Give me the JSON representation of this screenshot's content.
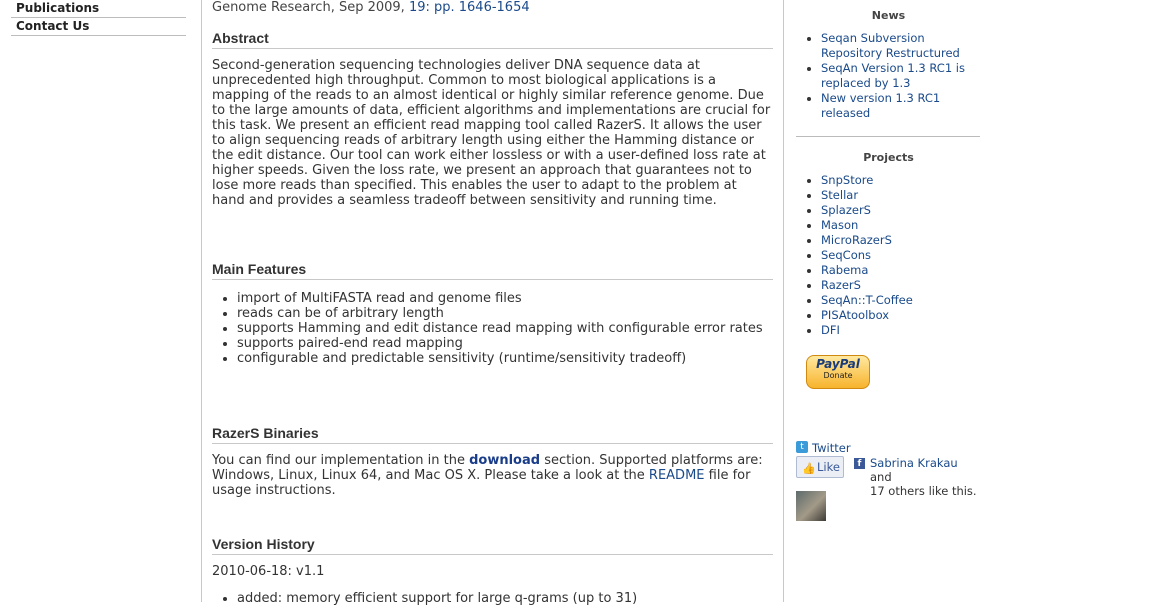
{
  "nav": {
    "items": [
      {
        "label": "Publications"
      },
      {
        "label": "Contact Us"
      }
    ]
  },
  "main": {
    "citation": {
      "text": "Genome Research, Sep 2009, ",
      "link": "19: pp. 1646-1654"
    },
    "abstract": {
      "heading": "Abstract",
      "text": "Second-generation sequencing technologies deliver DNA sequence data at unprecedented high throughput. Common to most biological applications is a mapping of the reads to an almost identical or highly similar reference genome. Due to the large amounts of data, efficient algorithms and implementations are crucial for this task. We present an efficient read mapping tool called RazerS. It allows the user to align sequencing reads of arbitrary length using either the Hamming distance or the edit distance. Our tool can work either lossless or with a user-defined loss rate at higher speeds. Given the loss rate, we present an approach that guarantees not to lose more reads than specified. This enables the user to adapt to the problem at hand and provides a seamless tradeoff between sensitivity and running time."
    },
    "features": {
      "heading": "Main Features",
      "items": [
        "import of MultiFASTA read and genome files",
        "reads can be of arbitrary length",
        "supports Hamming and edit distance read mapping with configurable error rates",
        "supports paired-end read mapping",
        "configurable and predictable sensitivity (runtime/sensitivity tradeoff)"
      ]
    },
    "binaries": {
      "heading": "RazerS Binaries",
      "text1": "You can find our implementation in the ",
      "download_link": "download",
      "text2": " section. Supported platforms are: Windows, Linux, Linux 64, and Mac OS X. Please take a look at the ",
      "readme_link": "README",
      "text3": " file for usage instructions."
    },
    "history": {
      "heading": "Version History",
      "version": "2010-06-18: v1.1",
      "items": [
        "added: memory efficient support for large q-grams (up to 31)"
      ]
    }
  },
  "sidebar": {
    "news": {
      "title": "News",
      "items": [
        "Seqan Subversion Repository Restructured",
        "SeqAn Version 1.3 RC1 is replaced by 1.3",
        "New version 1.3 RC1 released"
      ]
    },
    "projects": {
      "title": "Projects",
      "items": [
        "SnpStore",
        "Stellar",
        "SplazerS",
        "Mason",
        "MicroRazerS",
        "SeqCons",
        "Rabema",
        "RazerS",
        "SeqAn::T-Coffee",
        "PISAtoolbox",
        "DFI"
      ]
    },
    "paypal": {
      "brand": "PayPal",
      "label": "Donate"
    },
    "twitter": {
      "label": "Twitter"
    },
    "facebook": {
      "like_label": "Like",
      "user": "Sabrina Krakau",
      "suffix": " and",
      "others": "17 others like this."
    }
  },
  "colors": {
    "link": "#1a4a8a",
    "paypal_bg": "#f7b32c",
    "facebook": "#3b5998",
    "twitter": "#3a9bd8"
  }
}
